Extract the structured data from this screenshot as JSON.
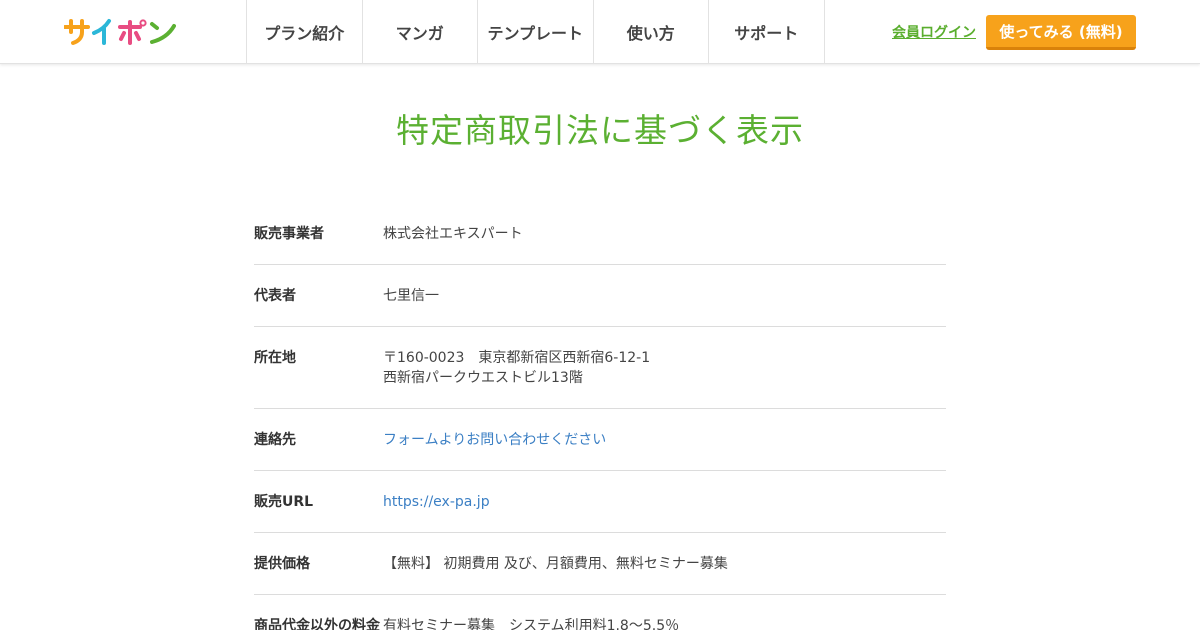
{
  "header": {
    "logo_text": "サイポン",
    "logo_colors": [
      "#f7a21b",
      "#2bb7d8",
      "#e84c82",
      "#5bb032"
    ],
    "nav": [
      {
        "label": "プラン紹介"
      },
      {
        "label": "マンガ"
      },
      {
        "label": "テンプレート"
      },
      {
        "label": "使い方"
      },
      {
        "label": "サポート"
      }
    ],
    "login_label": "会員ログイン",
    "cta_label": "使ってみる (無料)"
  },
  "main": {
    "title": "特定商取引法に基づく表示",
    "rows": [
      {
        "label": "販売事業者",
        "lines": [
          "株式会社エキスパート"
        ]
      },
      {
        "label": "代表者",
        "lines": [
          "七里信一"
        ]
      },
      {
        "label": "所在地",
        "lines": [
          "〒160-0023　東京都新宿区西新宿6-12-1",
          "西新宿パークウエストビル13階"
        ]
      },
      {
        "label": "連絡先",
        "lines": [
          "フォームよりお問い合わせください"
        ]
      },
      {
        "label": "販売URL",
        "lines": [
          "https://ex-pa.jp"
        ]
      },
      {
        "label": "提供価格",
        "lines": [
          "【無料】 初期費用 及び、月額費用、無料セミナー募集"
        ]
      },
      {
        "label": "商品代金以外の料金",
        "lines": [
          "有料セミナー募集　システム利用料1.8～5.5％"
        ]
      }
    ]
  },
  "colors": {
    "accent_green": "#5bb032",
    "cta_orange": "#f7a21b",
    "link_blue": "#3b7fc4"
  }
}
